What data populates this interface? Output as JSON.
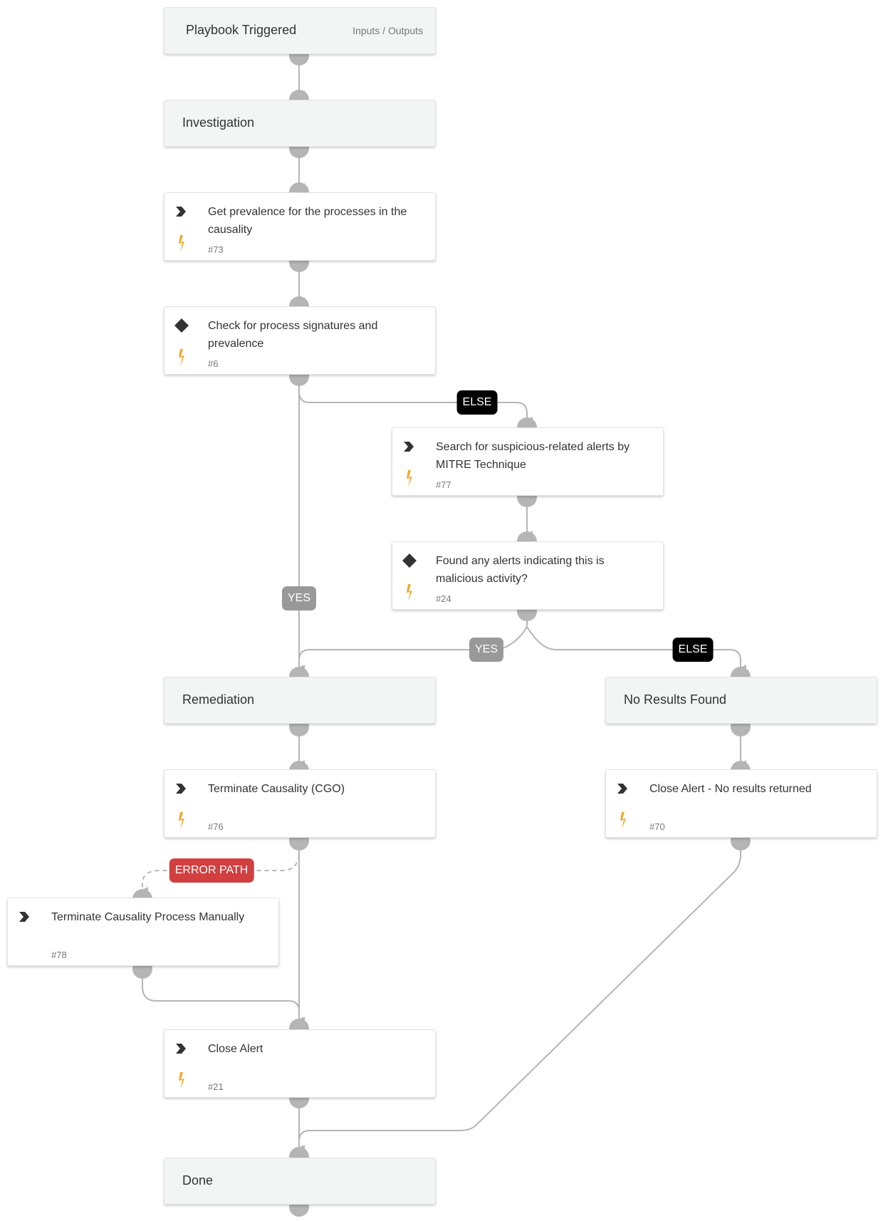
{
  "start": {
    "title": "Playbook Triggered",
    "io_link": "Inputs / Outputs"
  },
  "sections": {
    "investigation": "Investigation",
    "remediation": "Remediation",
    "no_results": "No Results Found",
    "done": "Done"
  },
  "tasks": {
    "t73": {
      "type": "task",
      "title": "Get prevalence for the processes in the causality",
      "id": "#73"
    },
    "t6": {
      "type": "condition",
      "title": "Check for process signatures and prevalence",
      "id": "#6"
    },
    "t77": {
      "type": "task",
      "title": "Search for suspicious-related alerts by MITRE Technique",
      "id": "#77"
    },
    "t24": {
      "type": "condition",
      "title": "Found any alerts indicating this is malicious activity?",
      "id": "#24"
    },
    "t76": {
      "type": "task",
      "title": "Terminate Causality (CGO)",
      "id": "#76"
    },
    "t70": {
      "type": "task",
      "title": "Close Alert - No results returned",
      "id": "#70"
    },
    "t78": {
      "type": "task",
      "title": "Terminate Causality Process Manually",
      "id": "#78"
    },
    "t21": {
      "type": "task",
      "title": "Close Alert",
      "id": "#21"
    }
  },
  "edge_labels": {
    "else1": "ELSE",
    "yes1": "YES",
    "yes2": "YES",
    "else2": "ELSE",
    "error": "ERROR PATH"
  },
  "colors": {
    "edge": "#b5b5b5",
    "else_label": "#000000",
    "yes_label": "#999999",
    "error_label": "#d13f3f",
    "bolt": "#f0a72b",
    "icon": "#333333"
  }
}
